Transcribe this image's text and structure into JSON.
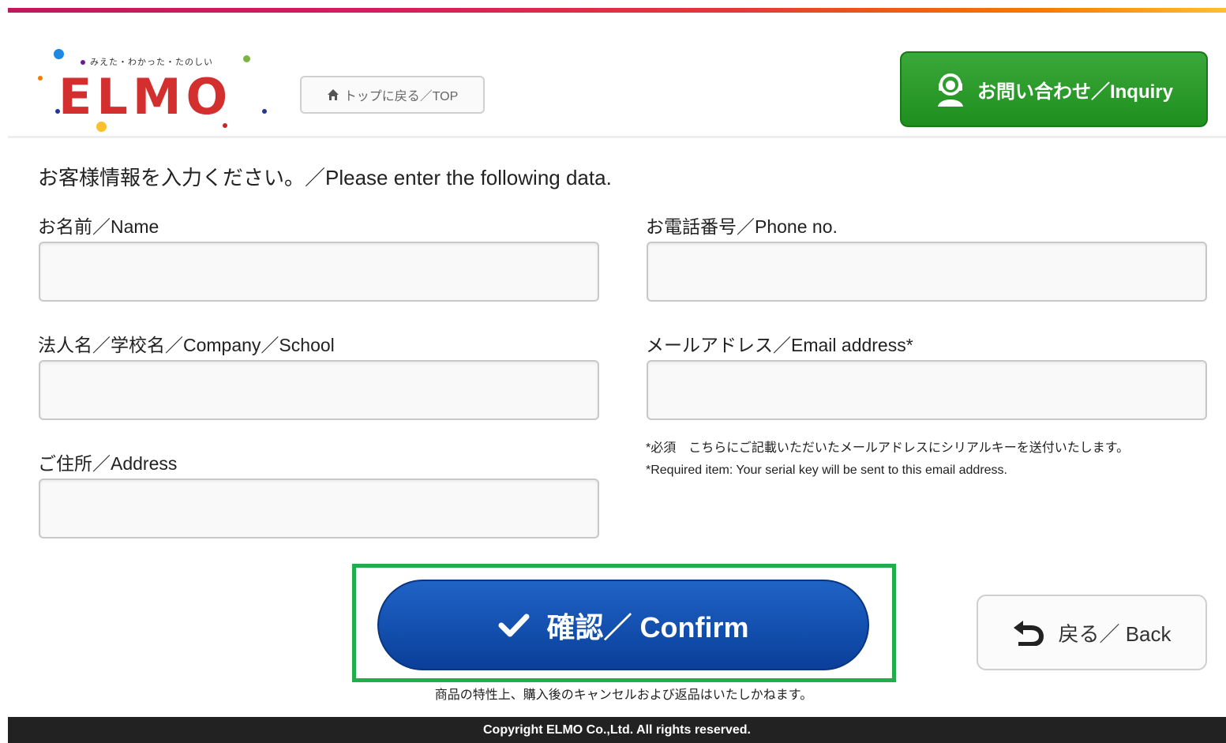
{
  "header": {
    "logo_tagline": "みえた・わかった・たのしい",
    "logo_text": "ELMO",
    "top_link_label": "トップに戻る／TOP",
    "inquiry_label": "お問い合わせ／Inquiry"
  },
  "form": {
    "intro": "お客様情報を入力ください。／Please enter the following data.",
    "fields": {
      "name": {
        "label": "お名前／Name",
        "value": ""
      },
      "phone": {
        "label": "お電話番号／Phone no.",
        "value": ""
      },
      "company": {
        "label": "法人名／学校名／Company／School",
        "value": ""
      },
      "email": {
        "label": "メールアドレス／Email address*",
        "value": ""
      },
      "address": {
        "label": "ご住所／Address",
        "value": ""
      }
    },
    "notes": {
      "line1": "*必須　こちらにご記載いただいたメールアドレスにシリアルキーを送付いたします。",
      "line2": "*Required item: Your serial key will be sent to this email address."
    }
  },
  "actions": {
    "confirm_label": "確認／ Confirm",
    "back_label": "戻る／ Back",
    "cancel_note": "商品の特性上、購入後のキャンセルおよび返品はいたしかねます。"
  },
  "footer": {
    "copyright": "Copyright ELMO Co.,Ltd. All rights reserved."
  },
  "colors": {
    "inquiry_green": "#1e8f1e",
    "confirm_blue": "#0a3f9a",
    "highlight_frame": "#1fae4b",
    "footer_bg": "#222222"
  }
}
